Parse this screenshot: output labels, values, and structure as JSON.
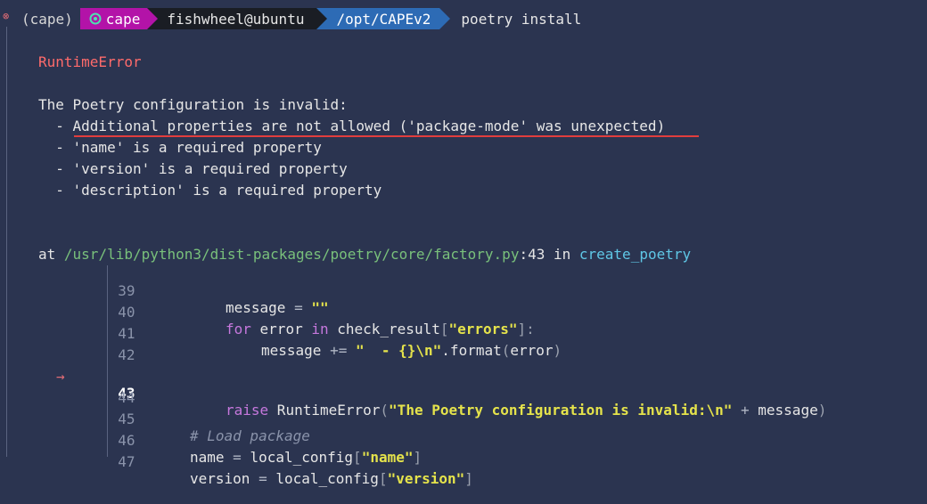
{
  "prompt": {
    "env": "(cape)",
    "venv": "cape",
    "user_host": "fishwheel@ubuntu",
    "cwd": "/opt/CAPEv2",
    "command": "poetry install"
  },
  "error": {
    "title": "RuntimeError",
    "message": "The Poetry configuration is invalid:",
    "items": [
      "  - Additional properties are not allowed ('package-mode' was unexpected)",
      "  - 'name' is a required property",
      "  - 'version' is a required property",
      "  - 'description' is a required property"
    ]
  },
  "trace": {
    "at": "at ",
    "file": "/usr/lib/python3/dist-packages/poetry/core/factory.py",
    "sep": ":",
    "line": "43",
    "in": " in ",
    "func": "create_poetry"
  },
  "code": {
    "marker": "→",
    "numbers": [
      "39",
      "40",
      "41",
      "42",
      "43",
      "44",
      "45",
      "46",
      "47"
    ],
    "l39": {
      "a": "message ",
      "b": "=",
      "c": " ",
      "d": "\"\""
    },
    "l40": {
      "a": "for",
      "b": " error ",
      "c": "in",
      "d": " check_result",
      "e": "[",
      "f": "\"errors\"",
      "g": "]:"
    },
    "l41": {
      "a": "message ",
      "b": "+=",
      "c": " ",
      "d": "\"  - {}\\n\"",
      "e": ".format",
      "f": "(",
      "g": "error",
      "h": ")"
    },
    "l43": {
      "a": "raise",
      "b": " RuntimeError",
      "c": "(",
      "d": "\"The Poetry configuration is invalid:\\n\"",
      "e": " ",
      "f": "+",
      "g": " message",
      "h": ")"
    },
    "l45": {
      "a": "# Load package"
    },
    "l46": {
      "a": "name ",
      "b": "=",
      "c": " local_config",
      "d": "[",
      "e": "\"name\"",
      "f": "]"
    },
    "l47": {
      "a": "version ",
      "b": "=",
      "c": " local_config",
      "d": "[",
      "e": "\"version\"",
      "f": "]"
    }
  }
}
